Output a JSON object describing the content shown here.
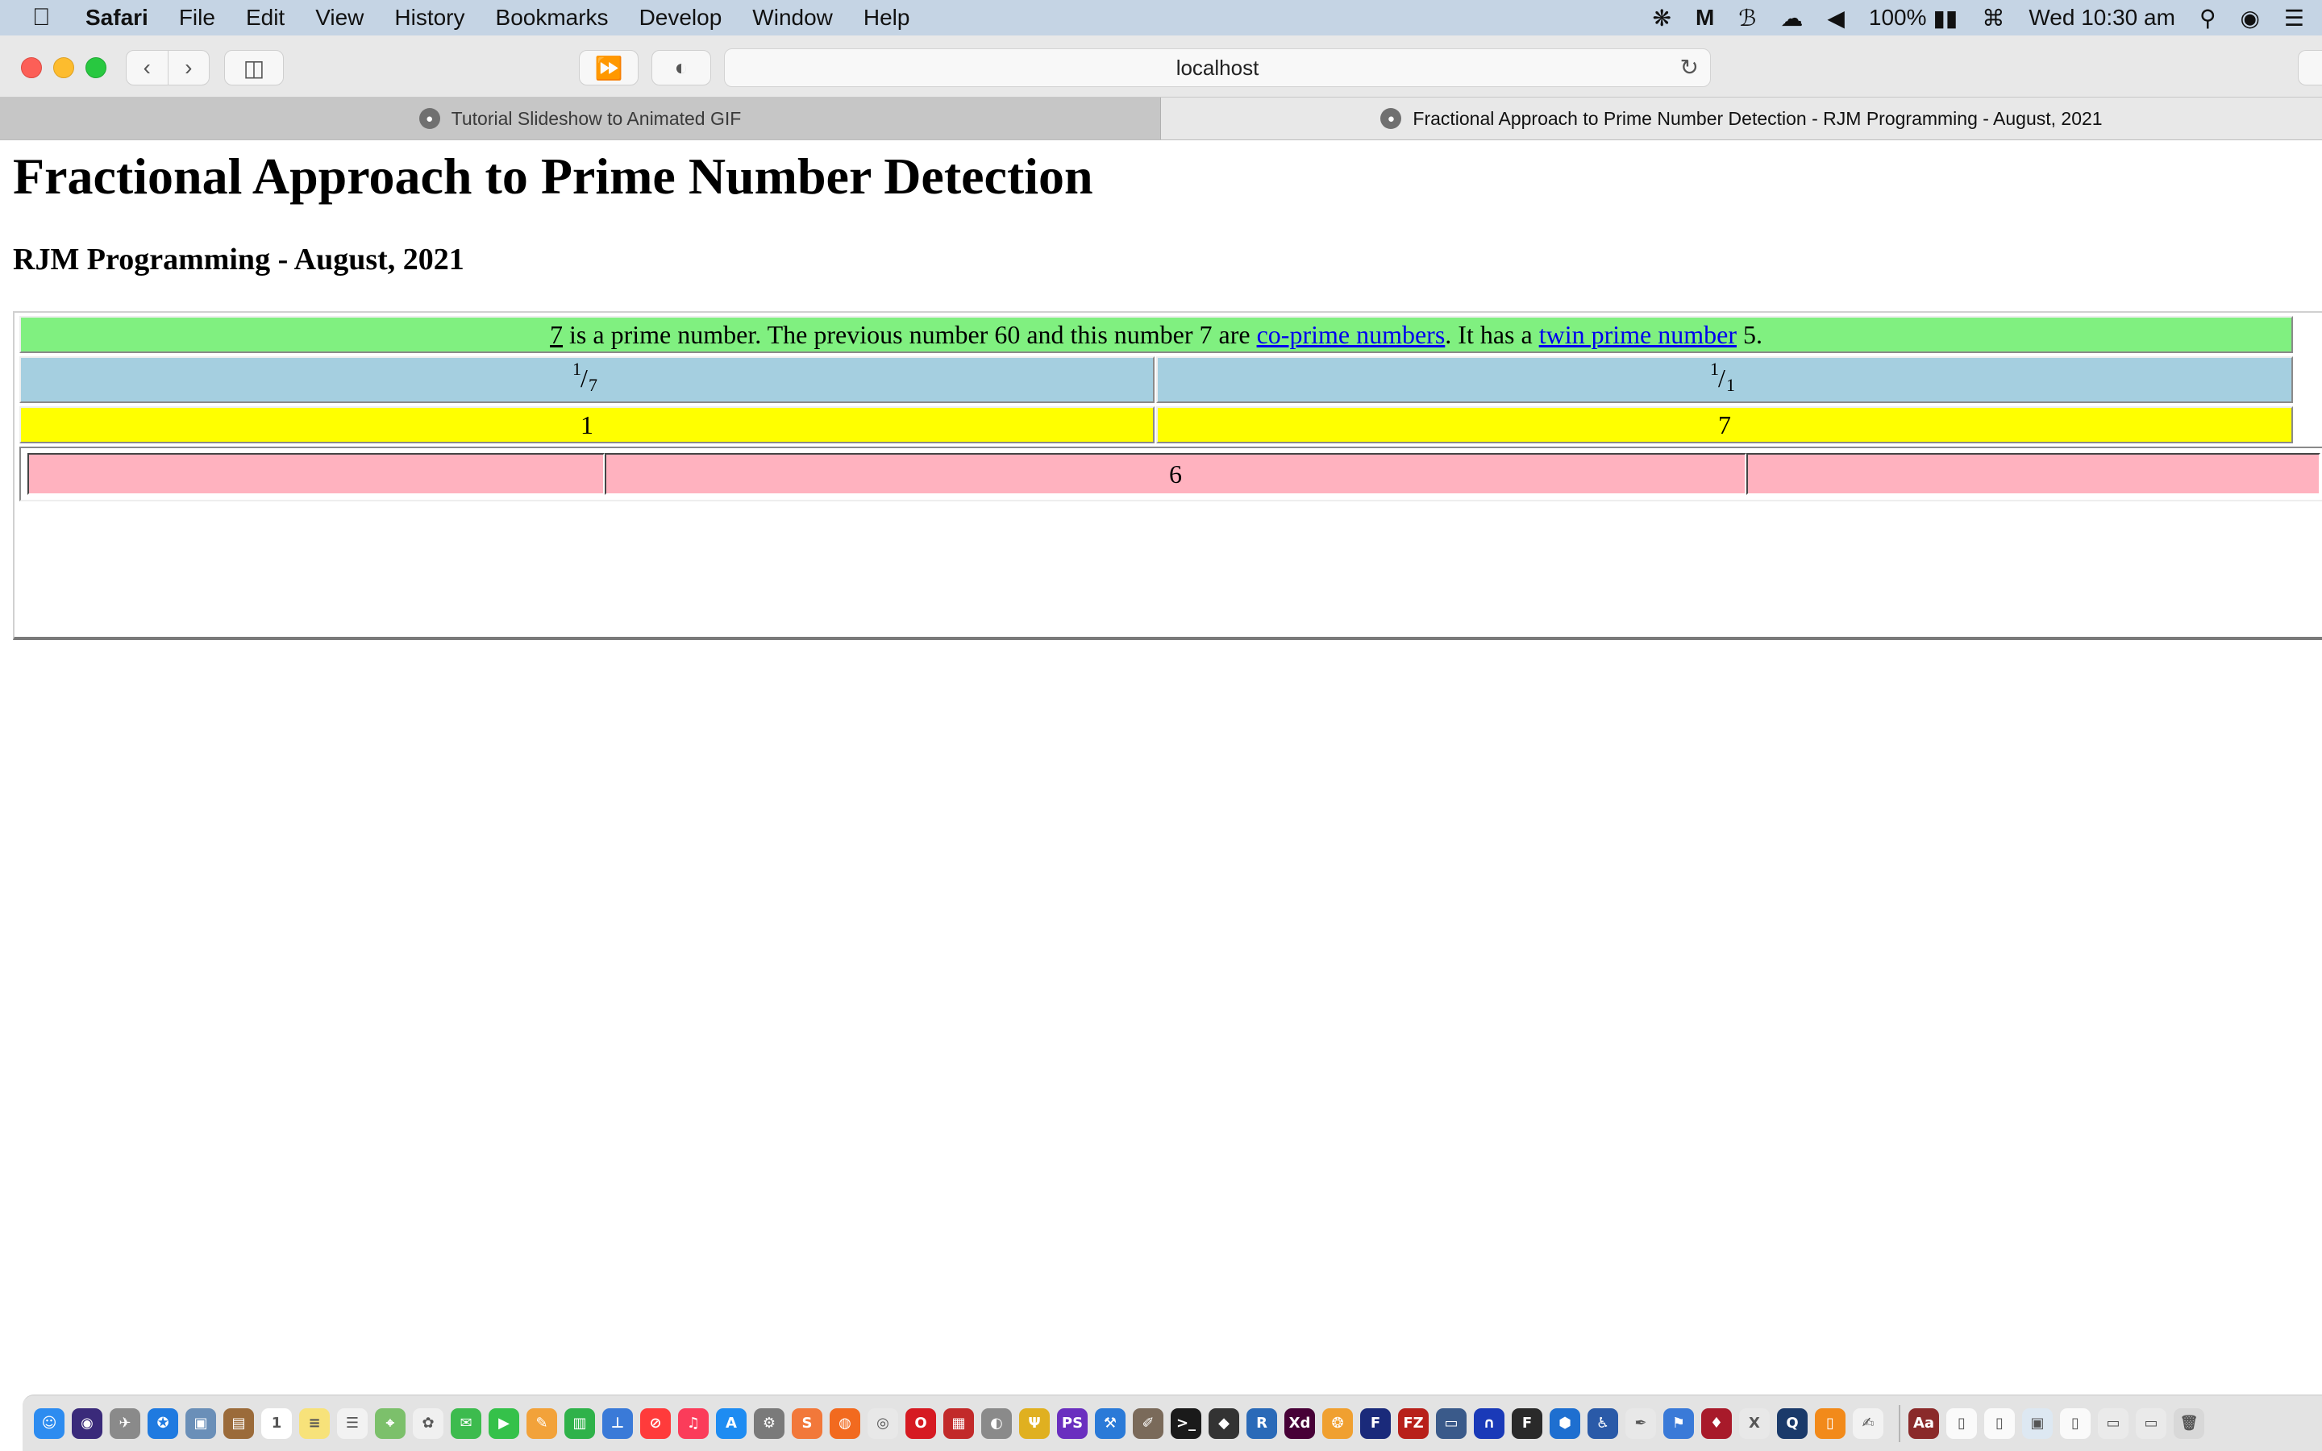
{
  "menubar": {
    "app_name": "Safari",
    "items": [
      "File",
      "Edit",
      "View",
      "History",
      "Bookmarks",
      "Develop",
      "Window",
      "Help"
    ],
    "battery": "100%",
    "clock": "Wed 10:30 am"
  },
  "toolbar": {
    "address": "localhost"
  },
  "tabs": [
    {
      "title": "Tutorial Slideshow to Animated GIF",
      "active": false
    },
    {
      "title": "Fractional Approach to Prime Number Detection - RJM Programming - August, 2021",
      "active": true
    }
  ],
  "page": {
    "title": "Fractional Approach to Prime Number Detection",
    "subtitle": "RJM Programming - August, 2021",
    "summary": {
      "number": "7",
      "text_1": " is a prime number. The previous number 60 and this number 7 are ",
      "link_coprime": "co-prime numbers",
      "text_2": ". It has a ",
      "link_twin": "twin prime number",
      "text_3": " 5."
    },
    "fractions": [
      {
        "numerator": "1",
        "denominator": "7"
      },
      {
        "numerator": "1",
        "denominator": "1"
      }
    ],
    "divisors": [
      "1",
      "7"
    ],
    "difference": "6",
    "colors": {
      "summary_row": "#80f080",
      "fraction_row": "#a5cfe0",
      "divisor_row": "#ffff00",
      "difference_row": "#ffb2bf",
      "link": "#0000ee"
    }
  },
  "dock": {
    "icons": [
      {
        "name": "finder-icon",
        "color": "#2d8cf0",
        "glyph": "☺"
      },
      {
        "name": "siri-icon",
        "color": "#3a2a7a",
        "glyph": "◉"
      },
      {
        "name": "launchpad-icon",
        "color": "#8a8a8a",
        "glyph": "✈"
      },
      {
        "name": "safari-icon",
        "color": "#1f7ae0",
        "glyph": "✪"
      },
      {
        "name": "preview-icon",
        "color": "#6a8fb8",
        "glyph": "▣"
      },
      {
        "name": "notebook-icon",
        "color": "#9b6b3a",
        "glyph": "▤"
      },
      {
        "name": "calendar-icon",
        "color": "#ffffff",
        "glyph": "1"
      },
      {
        "name": "notes-icon",
        "color": "#f7e27a",
        "glyph": "≡"
      },
      {
        "name": "reminders-icon",
        "color": "#f2f2f2",
        "glyph": "☰"
      },
      {
        "name": "maps-icon",
        "color": "#7cc06b",
        "glyph": "⌖"
      },
      {
        "name": "photos-icon",
        "color": "#f0f0f0",
        "glyph": "✿"
      },
      {
        "name": "messages-icon",
        "color": "#3dbb4e",
        "glyph": "✉"
      },
      {
        "name": "facetime-icon",
        "color": "#35c14a",
        "glyph": "▶"
      },
      {
        "name": "pages-icon",
        "color": "#f2a23a",
        "glyph": "✎"
      },
      {
        "name": "numbers-icon",
        "color": "#2fb24a",
        "glyph": "▥"
      },
      {
        "name": "keynote-icon",
        "color": "#3a7ad8",
        "glyph": "⊥"
      },
      {
        "name": "news-icon",
        "color": "#ff3b3b",
        "glyph": "⊘"
      },
      {
        "name": "music-icon",
        "color": "#fb3c5a",
        "glyph": "♫"
      },
      {
        "name": "app-store-icon",
        "color": "#1e8cf2",
        "glyph": "A"
      },
      {
        "name": "system-preferences-icon",
        "color": "#7a7a7a",
        "glyph": "⚙"
      },
      {
        "name": "sublime-icon",
        "color": "#f2783a",
        "glyph": "S"
      },
      {
        "name": "firefox-icon",
        "color": "#f26a1f",
        "glyph": "◍"
      },
      {
        "name": "chrome-icon",
        "color": "#e8e8e8",
        "glyph": "◎"
      },
      {
        "name": "opera-icon",
        "color": "#d61a22",
        "glyph": "O"
      },
      {
        "name": "photo-booth-icon",
        "color": "#c22a2a",
        "glyph": "▦"
      },
      {
        "name": "sequel-pro-icon",
        "color": "#8a8a8a",
        "glyph": "◐"
      },
      {
        "name": "filezilla-server-icon",
        "color": "#e0b020",
        "glyph": "Ψ"
      },
      {
        "name": "phpstorm-icon",
        "color": "#6a2fbf",
        "glyph": "PS"
      },
      {
        "name": "xcode-icon",
        "color": "#2a7ad8",
        "glyph": "⚒"
      },
      {
        "name": "gimp-icon",
        "color": "#7a6a5a",
        "glyph": "✐"
      },
      {
        "name": "terminal-icon",
        "color": "#1a1a1a",
        "glyph": ">_"
      },
      {
        "name": "inkscape-icon",
        "color": "#333333",
        "glyph": "◆"
      },
      {
        "name": "r-icon",
        "color": "#2a6ab8",
        "glyph": "R"
      },
      {
        "name": "adobe-xd-icon",
        "color": "#470137",
        "glyph": "Xd"
      },
      {
        "name": "blender-icon",
        "color": "#f0a030",
        "glyph": "❂"
      },
      {
        "name": "flashcard-icon",
        "color": "#1a2a7a",
        "glyph": "F"
      },
      {
        "name": "filezilla-icon",
        "color": "#b8201a",
        "glyph": "FZ"
      },
      {
        "name": "monitor-icon",
        "color": "#3a5a8a",
        "glyph": "▭"
      },
      {
        "name": "headphones-icon",
        "color": "#1a3ab8",
        "glyph": "∩"
      },
      {
        "name": "fontforge-icon",
        "color": "#2a2a2a",
        "glyph": "F"
      },
      {
        "name": "virtualbox-icon",
        "color": "#1e6fd0",
        "glyph": "⬢"
      },
      {
        "name": "accessibility-icon",
        "color": "#2a5aa8",
        "glyph": "♿"
      },
      {
        "name": "script-editor-icon",
        "color": "#e8e8e8",
        "glyph": "✒"
      },
      {
        "name": "xcode-instruments-icon",
        "color": "#3a7ad8",
        "glyph": "⚑"
      },
      {
        "name": "wine-icon",
        "color": "#a81a2a",
        "glyph": "♦"
      },
      {
        "name": "x11-icon",
        "color": "#e8e8e8",
        "glyph": "X"
      },
      {
        "name": "quicktime-icon",
        "color": "#1a3a6a",
        "glyph": "Q"
      },
      {
        "name": "books-icon",
        "color": "#f28a1a",
        "glyph": "▯"
      },
      {
        "name": "textedit-icon",
        "color": "#f2f2f2",
        "glyph": "✍"
      },
      {
        "name": "dictionary-icon",
        "color": "#8a2a2a",
        "glyph": "Aa"
      },
      {
        "name": "document-icon-1",
        "color": "#fafafa",
        "glyph": "▯"
      },
      {
        "name": "document-icon-2",
        "color": "#fafafa",
        "glyph": "▯"
      },
      {
        "name": "image-file-icon",
        "color": "#dde8f2",
        "glyph": "▣"
      },
      {
        "name": "document-icon-3",
        "color": "#fafafa",
        "glyph": "▯"
      },
      {
        "name": "screenshot-file-icon",
        "color": "#eaeaea",
        "glyph": "▭"
      },
      {
        "name": "screenshot-file-icon-2",
        "color": "#eaeaea",
        "glyph": "▭"
      },
      {
        "name": "trash-icon",
        "color": "#d8d8d8",
        "glyph": "🗑"
      }
    ]
  }
}
